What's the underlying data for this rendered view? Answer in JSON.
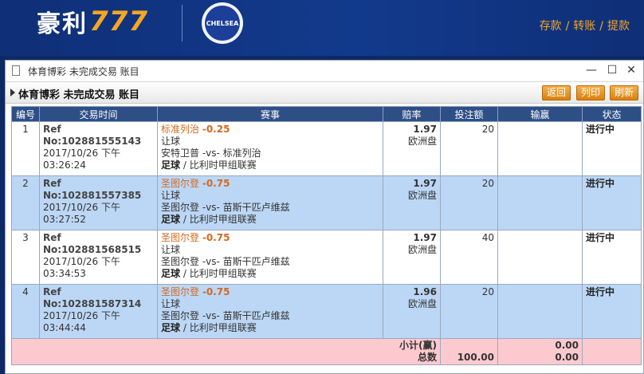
{
  "site": {
    "logo_text": "豪利",
    "logo_number": "777",
    "crest_text": "CHELSEA",
    "links": [
      "存款",
      "转账",
      "提款"
    ],
    "link_sep": "/"
  },
  "window": {
    "title": "体育博彩 未完成交易 账目",
    "header": "体育博彩 未完成交易 账目",
    "buttons": {
      "back": "返回",
      "print": "列印",
      "refresh": "刷新"
    },
    "controls": {
      "minimize": "—",
      "maximize": "☐",
      "close": "✕"
    }
  },
  "table": {
    "columns": [
      "编号",
      "交易时间",
      "赛事",
      "赔率",
      "投注额",
      "输赢",
      "状态"
    ],
    "rows": [
      {
        "no": "1",
        "ref": "Ref No:102881555143",
        "time": "2017/10/26 下午 03:26:24",
        "team": "标准列治",
        "handicap": "-0.25",
        "bet_type": "让球",
        "match": "安特卫普 -vs- 标准列治",
        "sport": "足球",
        "league": " / 比利时甲组联赛",
        "odds": "1.97",
        "odds_type": "欧洲盘",
        "stake": "20",
        "winloss": "",
        "status": "进行中"
      },
      {
        "no": "2",
        "ref": "Ref No:102881557385",
        "time": "2017/10/26 下午 03:27:52",
        "team": "圣图尔登",
        "handicap": "-0.75",
        "bet_type": "让球",
        "match": "圣图尔登 -vs- 苗斯干匹卢维兹",
        "sport": "足球",
        "league": " / 比利时甲组联赛",
        "odds": "1.97",
        "odds_type": "欧洲盘",
        "stake": "20",
        "winloss": "",
        "status": "进行中"
      },
      {
        "no": "3",
        "ref": "Ref No:102881568515",
        "time": "2017/10/26 下午 03:34:53",
        "team": "圣图尔登",
        "handicap": "-0.75",
        "bet_type": "让球",
        "match": "圣图尔登 -vs- 苗斯干匹卢维兹",
        "sport": "足球",
        "league": " / 比利时甲组联赛",
        "odds": "1.97",
        "odds_type": "欧洲盘",
        "stake": "40",
        "winloss": "",
        "status": "进行中"
      },
      {
        "no": "4",
        "ref": "Ref No:102881587314",
        "time": "2017/10/26 下午 03:44:44",
        "team": "圣图尔登",
        "handicap": "-0.75",
        "bet_type": "让球",
        "match": "圣图尔登 -vs- 苗斯干匹卢维兹",
        "sport": "足球",
        "league": " / 比利时甲组联赛",
        "odds": "1.96",
        "odds_type": "欧洲盘",
        "stake": "20",
        "winloss": "",
        "status": "进行中"
      }
    ],
    "summary": {
      "subtotal_label": "小计(赢)",
      "total_label": "总数",
      "subtotal_stake": "",
      "total_stake": "100.00",
      "subtotal_winloss": "0.00",
      "total_winloss": "0.00"
    }
  },
  "colors": {
    "header_bg": "#2e4f86",
    "alt_row": "#bcd7f5",
    "summary_row": "#fcc9cf",
    "accent": "#f5a623",
    "team": "#d2691e"
  }
}
